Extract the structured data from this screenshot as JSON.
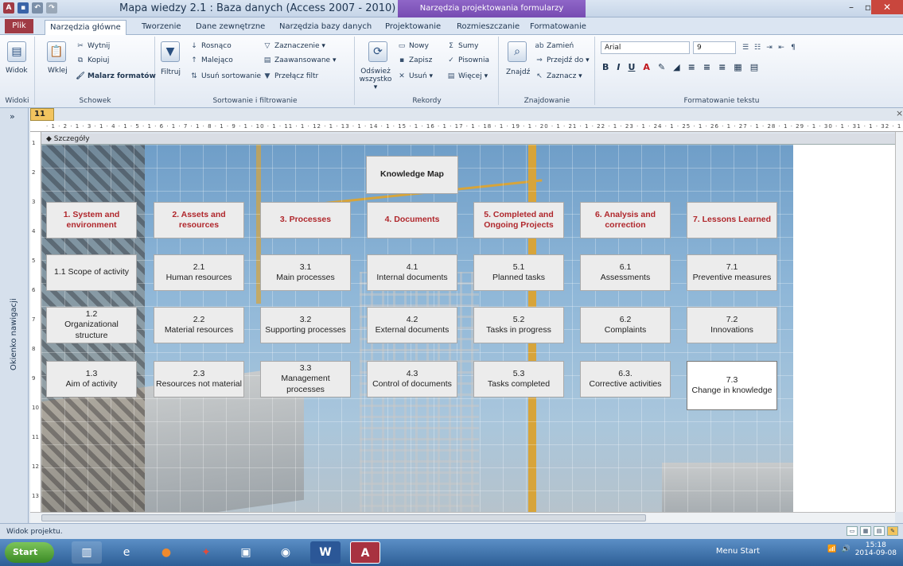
{
  "window": {
    "title": "Mapa wiedzy 2.1 : Baza danych (Access 2007 - 2010) M...",
    "context_tools": "Narzędzia projektowania formularzy",
    "minimize": "–",
    "maximize": "▫",
    "close": "✕"
  },
  "tabs": [
    "Plik",
    "Narzędzia główne",
    "Tworzenie",
    "Dane zewnętrzne",
    "Narzędzia bazy danych",
    "Projektowanie",
    "Rozmieszczanie",
    "Formatowanie"
  ],
  "ribbon": {
    "widoki": {
      "view_label": "Widok",
      "title": "Widoki"
    },
    "schowek": {
      "paste": "Wklej",
      "cut": "Wytnij",
      "copy": "Kopiuj",
      "format_painter": "Malarz formatów",
      "title": "Schowek"
    },
    "sortowanie": {
      "filter": "Filtruj",
      "asc": "Rosnąco",
      "desc": "Malejąco",
      "remove_sort": "Usuń sortowanie",
      "selection": "Zaznaczenie ▾",
      "advanced": "Zaawansowane ▾",
      "toggle_filter": "Przełącz filtr",
      "title": "Sortowanie i filtrowanie"
    },
    "rekordy": {
      "refresh": "Odśwież wszystko ▾",
      "new": "Nowy",
      "save": "Zapisz",
      "delete": "Usuń ▾",
      "totals": "Sumy",
      "spelling": "Pisownia",
      "more": "Więcej ▾",
      "title": "Rekordy"
    },
    "znajdowanie": {
      "find": "Znajdź",
      "replace": "Zamień",
      "goto": "Przejdź do ▾",
      "select": "Zaznacz ▾",
      "title": "Znajdowanie"
    },
    "formatowanie": {
      "font": "Arial",
      "size": "9",
      "bold": "B",
      "italic": "I",
      "underline": "U",
      "title": "Formatowanie tekstu"
    }
  },
  "nav": {
    "label": "Okienko nawigacji",
    "toggle": "»"
  },
  "document": {
    "tab_label": "11",
    "section": "◆ Szczegóły",
    "close": "×"
  },
  "ruler": {
    "h": "· 1 · 2 · 1 · 3 · 1 · 4 · 1 · 5 · 1 · 6 · 1 · 7 · 1 · 8 · 1 · 9 · 1 · 10 · 1 · 11 · 1 · 12 · 1 · 13 · 1 · 14 · 1 · 15 · 1 · 16 · 1 · 17 · 1 · 18 · 1 · 19 · 1 · 20 · 1 · 21 · 1 · 22 · 1 · 23 · 1 · 24 · 1 · 25 · 1 · 26 · 1 · 27 · 1 · 28 · 1 · 29 · 1 · 30 · 1 · 31 · 1 · 32 · 1 ·",
    "v": [
      "1",
      "2",
      "3",
      "4",
      "5",
      "6",
      "7",
      "8",
      "9",
      "10",
      "11",
      "12",
      "13"
    ]
  },
  "knowledge_map": {
    "title": "Knowledge Map",
    "columns": [
      {
        "head": "1. System and environment",
        "items": [
          "1.1 Scope of activity",
          "1.2\nOrganizational structure",
          "1.3\nAim of activity"
        ]
      },
      {
        "head": "2. Assets and resources",
        "items": [
          "2.1\nHuman resources",
          "2.2\nMaterial resources",
          "2.3\nResources not material"
        ]
      },
      {
        "head": "3. Processes",
        "items": [
          "3.1\nMain processes",
          "3.2\nSupporting processes",
          "3.3\nManagement processes"
        ]
      },
      {
        "head": "4. Documents",
        "items": [
          "4.1\nInternal documents",
          "4.2\nExternal documents",
          "4.3\nControl of documents"
        ]
      },
      {
        "head": "5. Completed and Ongoing Projects",
        "items": [
          "5.1\nPlanned tasks",
          "5.2\nTasks in progress",
          "5.3\nTasks completed"
        ]
      },
      {
        "head": "6. Analysis and correction",
        "items": [
          "6.1\nAssessments",
          "6.2\nComplaints",
          "6.3.\nCorrective activities"
        ]
      },
      {
        "head": "7. Lessons Learned",
        "items": [
          "7.1\nPreventive measures",
          "7.2\nInnovations",
          "7.3\nChange in knowledge"
        ]
      }
    ]
  },
  "status": {
    "text": "Widok projektu."
  },
  "taskbar": {
    "start": "Start",
    "menu_start": "Menu Start",
    "time": "15:18",
    "date": "2014-09-08"
  }
}
